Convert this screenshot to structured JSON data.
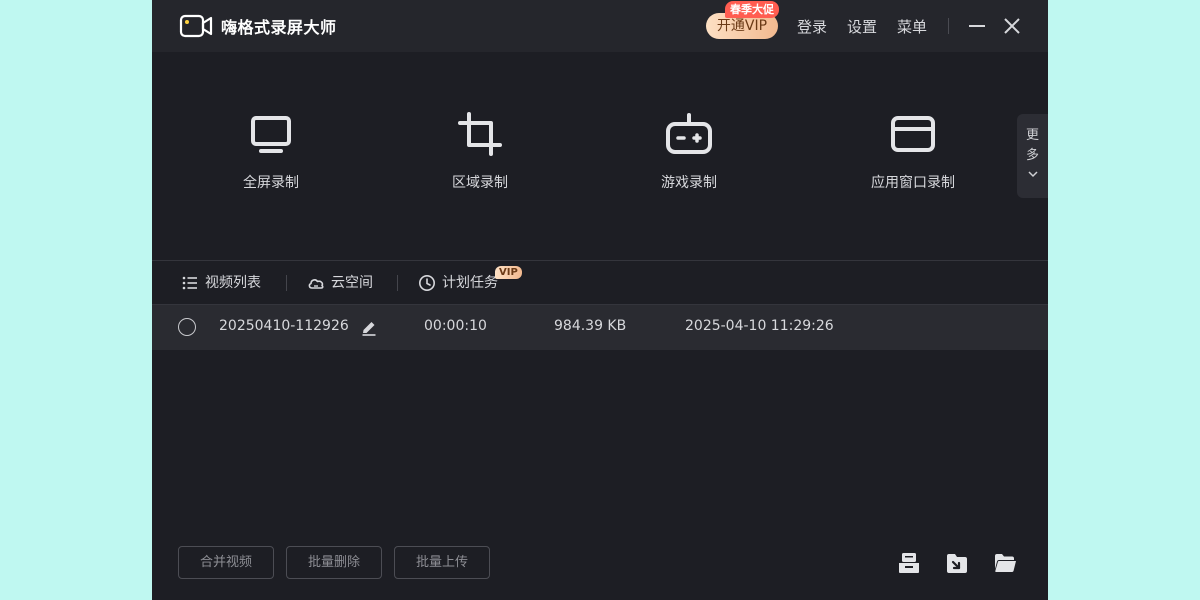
{
  "app": {
    "title": "嗨格式录屏大师"
  },
  "titlebar": {
    "vip_button": "开通VIP",
    "promo_badge": "春季大促",
    "login": "登录",
    "settings": "设置",
    "menu": "菜单"
  },
  "modes": [
    {
      "label": "全屏录制",
      "icon": "monitor-icon"
    },
    {
      "label": "区域录制",
      "icon": "crop-icon"
    },
    {
      "label": "游戏录制",
      "icon": "gamepad-icon"
    },
    {
      "label": "应用窗口录制",
      "icon": "window-icon"
    }
  ],
  "more": {
    "char1": "更",
    "char2": "多"
  },
  "tabs": [
    {
      "label": "视频列表",
      "icon": "list-icon"
    },
    {
      "label": "云空间",
      "icon": "cloud-icon"
    },
    {
      "label": "计划任务",
      "icon": "clock-icon",
      "badge": "VIP"
    }
  ],
  "files": [
    {
      "name": "20250410-112926",
      "duration": "00:00:10",
      "size": "984.39 KB",
      "date": "2025-04-10 11:29:26"
    }
  ],
  "bottom": {
    "merge": "合并视频",
    "batch_delete": "批量删除",
    "batch_upload": "批量上传",
    "icons": [
      "import-icon",
      "export-icon",
      "folder-icon"
    ]
  },
  "colors": {
    "background": "#1d1e24",
    "titlebar": "#25262c",
    "row_highlight": "#2a2b31",
    "vip_gradient_start": "#fde0c4",
    "vip_gradient_end": "#f2b98f",
    "promo_red": "#ff5d51",
    "page_backdrop": "#bff8f1"
  }
}
